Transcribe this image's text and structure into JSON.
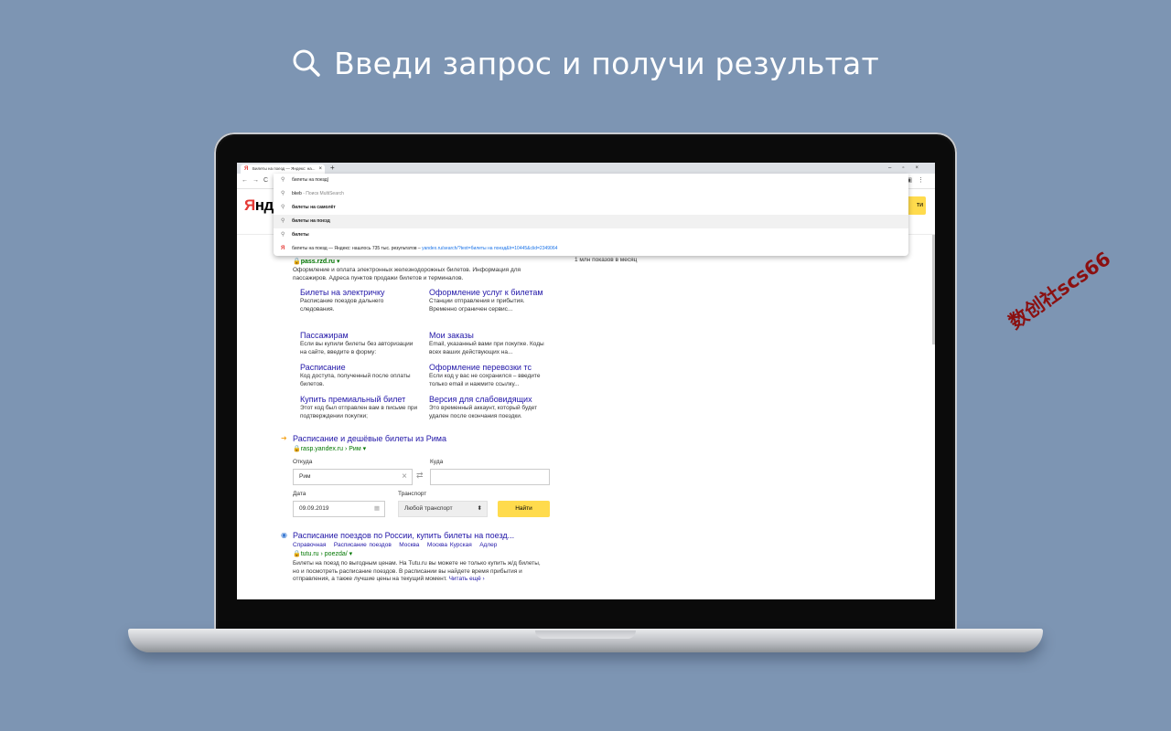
{
  "headline": "Введи запрос и получи результат",
  "browser": {
    "tab_title": "Билеты на поезд — Яндекс: на...",
    "tab_favicon": "Я",
    "omnibox_value": "билеты на поезд",
    "suggestions": [
      {
        "text": "bkeb",
        "hint": " - Поиск MultiSearch"
      },
      {
        "text": "билеты на самолёт",
        "hint": ""
      },
      {
        "text": "билеты на поезд",
        "hint": ""
      },
      {
        "text": "билеты",
        "hint": ""
      }
    ],
    "yandex_suggestion": {
      "text": "билеты на поезд — Яндекс: нашлось 735 тыс. результатов",
      "url": "yandex.ru/search/?text=билеты на поезд&lr=10445&clid=2349064"
    }
  },
  "page": {
    "logo": "Янде",
    "logo_first": "Я",
    "logo_rest": "нде",
    "search_button": "ти",
    "ads_count": "1 млн показов в месяц",
    "result1": {
      "domain": "pass.rzd.ru",
      "snippet": "Оформление и оплата электронных железнодорожных билетов. Информация для пассажиров. Адреса пунктов продажи билетов и терминалов.",
      "sitelinks": [
        {
          "title": "Билеты на электричку",
          "desc": "Расписание поездов дальнего следования."
        },
        {
          "title": "Оформление услуг к билетам",
          "desc": "Станции отправления и прибытия. Временно ограничен сервис..."
        },
        {
          "title": "Пассажирам",
          "desc": "Если вы купили билеты без авторизации на сайте, введите в форму:"
        },
        {
          "title": "Мои заказы",
          "desc": "Email, указанный вами при покупке. Коды всех ваших действующих на..."
        },
        {
          "title": "Расписание",
          "desc": "Код доступа, полученный после оплаты билетов."
        },
        {
          "title": "Оформление перевозки тс",
          "desc": "Если код у вас не сохранился – введите только email и нажмите ссылку..."
        },
        {
          "title": "Купить премиальный билет",
          "desc": "Этот код был отправлен вам в письме при подтверждении покупки;"
        },
        {
          "title": "Версия для слабовидящих",
          "desc": "Это временный аккаунт, который будет удален после окончания поездки."
        }
      ]
    },
    "result2": {
      "title": "Расписание и дешёвые билеты из Рима",
      "domain": "rasp.yandex.ru › Рим ▾",
      "from_label": "Откуда",
      "to_label": "Куда",
      "from_value": "Рим",
      "to_value": "",
      "date_label": "Дата",
      "date_value": "09.09.2019",
      "transport_label": "Транспорт",
      "transport_value": "Любой транспорт",
      "find_button": "Найти"
    },
    "result3": {
      "title": "Расписание поездов по России, купить билеты на поезд...",
      "breadcrumbs": [
        "Справочная",
        "Расписание поездов",
        "Москва",
        "Москва Курская",
        "Адлер"
      ],
      "domain": "tutu.ru › poezda/ ▾",
      "snippet": "Билеты на поезд по выгодным ценам. На Tutu.ru вы можете не только купить ж/д билеты, но и посмотреть расписание поездов. В расписании вы найдете время прибытия и отправления, а также лучшие цены на текущий момент.",
      "read_more": "Читать ещё ›"
    }
  },
  "watermark": "数创社scs66"
}
